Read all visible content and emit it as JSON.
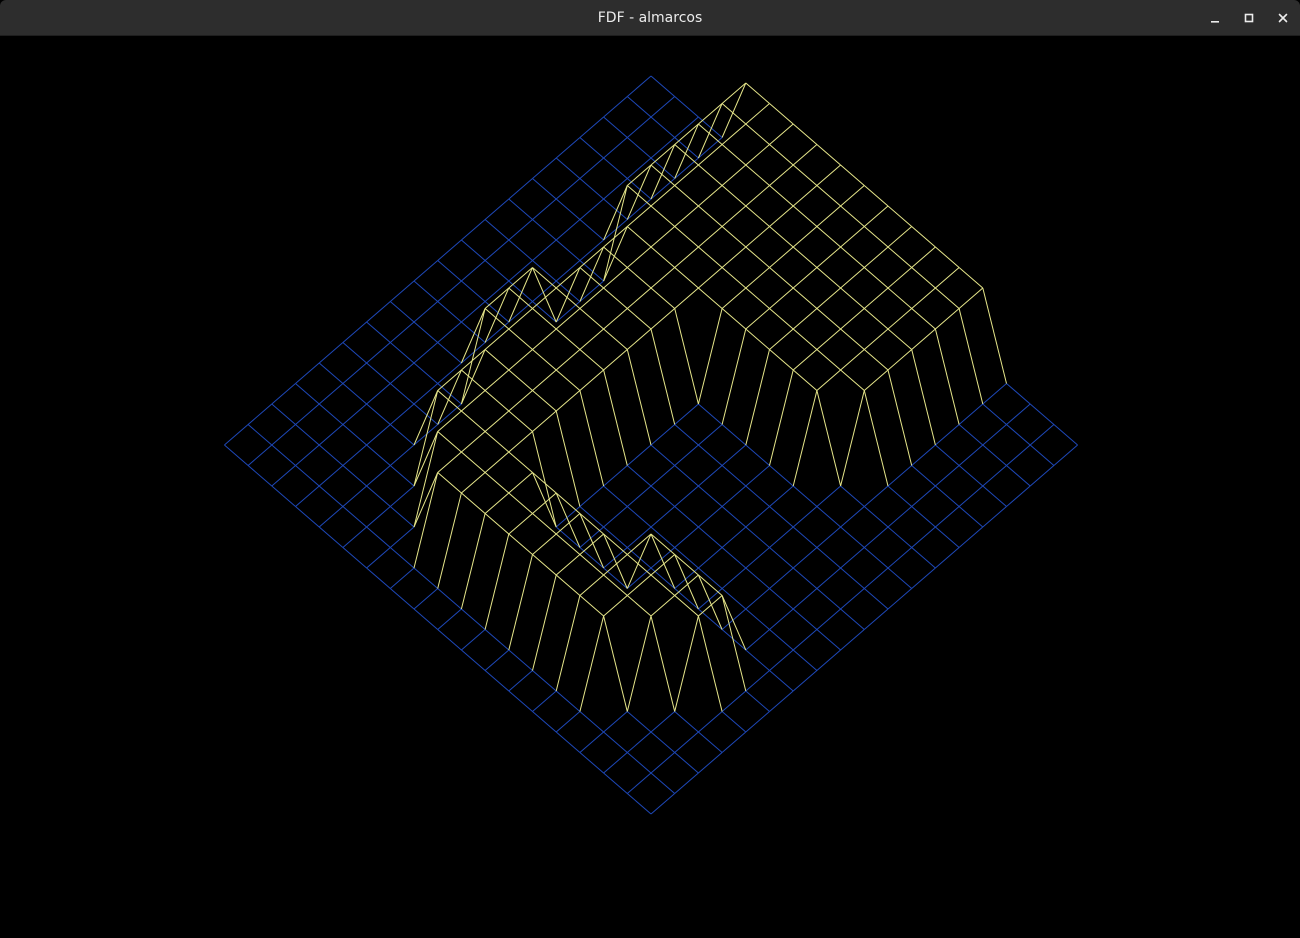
{
  "window": {
    "title": "FDF - almarcos",
    "buttons": {
      "minimize": "minimize-icon",
      "maximize": "maximize-icon",
      "close": "close-icon"
    }
  },
  "render": {
    "background_color": "#000000",
    "low_color": "#1e48b8",
    "high_color": "#e6e68a",
    "grid_columns": 19,
    "grid_rows": 19,
    "elevated_cells": [
      [
        0,
        4
      ],
      [
        0,
        5
      ],
      [
        0,
        6
      ],
      [
        0,
        7
      ],
      [
        0,
        8
      ],
      [
        0,
        9
      ],
      [
        0,
        10
      ],
      [
        0,
        11
      ],
      [
        0,
        12
      ],
      [
        0,
        13
      ],
      [
        0,
        14
      ],
      [
        1,
        4
      ],
      [
        1,
        5
      ],
      [
        1,
        6
      ],
      [
        1,
        7
      ],
      [
        1,
        8
      ],
      [
        1,
        9
      ],
      [
        1,
        10
      ],
      [
        1,
        11
      ],
      [
        1,
        12
      ],
      [
        1,
        13
      ],
      [
        1,
        14
      ],
      [
        2,
        4
      ],
      [
        2,
        5
      ],
      [
        2,
        6
      ],
      [
        2,
        7
      ],
      [
        2,
        8
      ],
      [
        2,
        9
      ],
      [
        2,
        10
      ],
      [
        2,
        11
      ],
      [
        2,
        12
      ],
      [
        2,
        13
      ],
      [
        2,
        14
      ],
      [
        3,
        4
      ],
      [
        3,
        5
      ],
      [
        3,
        6
      ],
      [
        3,
        7
      ],
      [
        3,
        8
      ],
      [
        3,
        9
      ],
      [
        3,
        10
      ],
      [
        3,
        11
      ],
      [
        3,
        12
      ],
      [
        3,
        13
      ],
      [
        3,
        14
      ],
      [
        4,
        4
      ],
      [
        4,
        5
      ],
      [
        4,
        6
      ],
      [
        4,
        7
      ],
      [
        4,
        8
      ],
      [
        4,
        9
      ],
      [
        4,
        10
      ],
      [
        4,
        11
      ],
      [
        4,
        12
      ],
      [
        4,
        13
      ],
      [
        4,
        14
      ],
      [
        5,
        4
      ],
      [
        5,
        5
      ],
      [
        5,
        6
      ],
      [
        5,
        7
      ],
      [
        5,
        8
      ],
      [
        5,
        9
      ],
      [
        5,
        10
      ],
      [
        5,
        11
      ],
      [
        5,
        12
      ],
      [
        5,
        13
      ],
      [
        5,
        14
      ],
      [
        6,
        5
      ],
      [
        6,
        6
      ],
      [
        6,
        7
      ],
      [
        6,
        8
      ],
      [
        6,
        9
      ],
      [
        6,
        10
      ],
      [
        6,
        11
      ],
      [
        6,
        12
      ],
      [
        6,
        13
      ],
      [
        7,
        5
      ],
      [
        7,
        6
      ],
      [
        7,
        7
      ],
      [
        7,
        8
      ],
      [
        8,
        5
      ],
      [
        8,
        6
      ],
      [
        8,
        7
      ],
      [
        8,
        8
      ],
      [
        9,
        4
      ],
      [
        9,
        5
      ],
      [
        9,
        6
      ],
      [
        9,
        7
      ],
      [
        9,
        8
      ],
      [
        10,
        4
      ],
      [
        10,
        5
      ],
      [
        10,
        6
      ],
      [
        10,
        7
      ],
      [
        10,
        8
      ],
      [
        11,
        4
      ],
      [
        11,
        5
      ],
      [
        11,
        6
      ],
      [
        11,
        7
      ],
      [
        11,
        8
      ],
      [
        12,
        5
      ],
      [
        12,
        6
      ],
      [
        12,
        7
      ],
      [
        12,
        8
      ],
      [
        13,
        5
      ],
      [
        13,
        6
      ],
      [
        13,
        7
      ],
      [
        13,
        8
      ],
      [
        13,
        13
      ],
      [
        13,
        14
      ],
      [
        13,
        15
      ],
      [
        13,
        16
      ],
      [
        14,
        5
      ],
      [
        14,
        6
      ],
      [
        14,
        7
      ],
      [
        14,
        8
      ],
      [
        14,
        9
      ],
      [
        14,
        10
      ],
      [
        14,
        11
      ],
      [
        14,
        12
      ],
      [
        14,
        13
      ],
      [
        14,
        14
      ],
      [
        14,
        15
      ],
      [
        14,
        16
      ],
      [
        15,
        6
      ],
      [
        15,
        7
      ],
      [
        15,
        8
      ],
      [
        15,
        9
      ],
      [
        15,
        10
      ],
      [
        15,
        11
      ],
      [
        15,
        12
      ],
      [
        15,
        13
      ],
      [
        15,
        14
      ],
      [
        15,
        15
      ],
      [
        16,
        7
      ],
      [
        16,
        8
      ],
      [
        16,
        9
      ],
      [
        16,
        10
      ],
      [
        16,
        11
      ],
      [
        16,
        12
      ],
      [
        16,
        13
      ],
      [
        16,
        14
      ]
    ]
  }
}
